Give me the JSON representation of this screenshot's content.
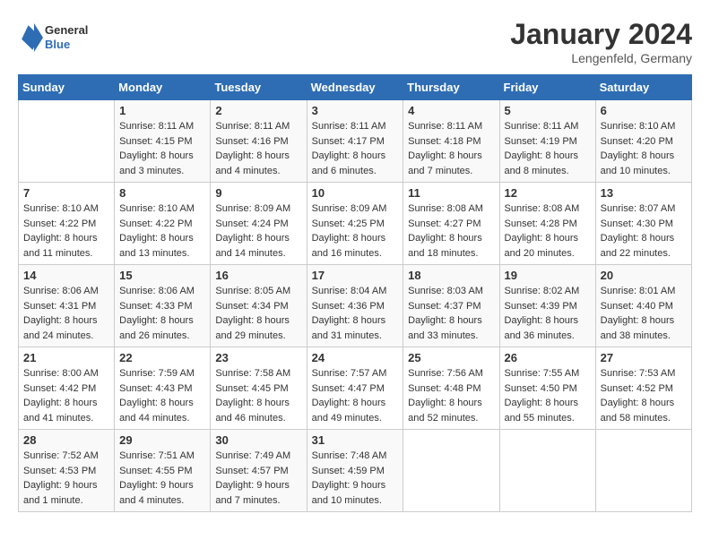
{
  "header": {
    "logo_general": "General",
    "logo_blue": "Blue",
    "title": "January 2024",
    "location": "Lengenfeld, Germany"
  },
  "days_of_week": [
    "Sunday",
    "Monday",
    "Tuesday",
    "Wednesday",
    "Thursday",
    "Friday",
    "Saturday"
  ],
  "weeks": [
    [
      {
        "day": "",
        "info": ""
      },
      {
        "day": "1",
        "info": "Sunrise: 8:11 AM\nSunset: 4:15 PM\nDaylight: 8 hours\nand 3 minutes."
      },
      {
        "day": "2",
        "info": "Sunrise: 8:11 AM\nSunset: 4:16 PM\nDaylight: 8 hours\nand 4 minutes."
      },
      {
        "day": "3",
        "info": "Sunrise: 8:11 AM\nSunset: 4:17 PM\nDaylight: 8 hours\nand 6 minutes."
      },
      {
        "day": "4",
        "info": "Sunrise: 8:11 AM\nSunset: 4:18 PM\nDaylight: 8 hours\nand 7 minutes."
      },
      {
        "day": "5",
        "info": "Sunrise: 8:11 AM\nSunset: 4:19 PM\nDaylight: 8 hours\nand 8 minutes."
      },
      {
        "day": "6",
        "info": "Sunrise: 8:10 AM\nSunset: 4:20 PM\nDaylight: 8 hours\nand 10 minutes."
      }
    ],
    [
      {
        "day": "7",
        "info": ""
      },
      {
        "day": "8",
        "info": "Sunrise: 8:10 AM\nSunset: 4:22 PM\nDaylight: 8 hours\nand 13 minutes."
      },
      {
        "day": "9",
        "info": "Sunrise: 8:09 AM\nSunset: 4:24 PM\nDaylight: 8 hours\nand 14 minutes."
      },
      {
        "day": "10",
        "info": "Sunrise: 8:09 AM\nSunset: 4:25 PM\nDaylight: 8 hours\nand 16 minutes."
      },
      {
        "day": "11",
        "info": "Sunrise: 8:08 AM\nSunset: 4:27 PM\nDaylight: 8 hours\nand 18 minutes."
      },
      {
        "day": "12",
        "info": "Sunrise: 8:08 AM\nSunset: 4:28 PM\nDaylight: 8 hours\nand 20 minutes."
      },
      {
        "day": "13",
        "info": "Sunrise: 8:07 AM\nSunset: 4:30 PM\nDaylight: 8 hours\nand 22 minutes."
      }
    ],
    [
      {
        "day": "14",
        "info": ""
      },
      {
        "day": "15",
        "info": "Sunrise: 8:06 AM\nSunset: 4:33 PM\nDaylight: 8 hours\nand 26 minutes."
      },
      {
        "day": "16",
        "info": "Sunrise: 8:05 AM\nSunset: 4:34 PM\nDaylight: 8 hours\nand 29 minutes."
      },
      {
        "day": "17",
        "info": "Sunrise: 8:04 AM\nSunset: 4:36 PM\nDaylight: 8 hours\nand 31 minutes."
      },
      {
        "day": "18",
        "info": "Sunrise: 8:03 AM\nSunset: 4:37 PM\nDaylight: 8 hours\nand 33 minutes."
      },
      {
        "day": "19",
        "info": "Sunrise: 8:02 AM\nSunset: 4:39 PM\nDaylight: 8 hours\nand 36 minutes."
      },
      {
        "day": "20",
        "info": "Sunrise: 8:01 AM\nSunset: 4:40 PM\nDaylight: 8 hours\nand 38 minutes."
      }
    ],
    [
      {
        "day": "21",
        "info": ""
      },
      {
        "day": "22",
        "info": "Sunrise: 7:59 AM\nSunset: 4:43 PM\nDaylight: 8 hours\nand 44 minutes."
      },
      {
        "day": "23",
        "info": "Sunrise: 7:58 AM\nSunset: 4:45 PM\nDaylight: 8 hours\nand 46 minutes."
      },
      {
        "day": "24",
        "info": "Sunrise: 7:57 AM\nSunset: 4:47 PM\nDaylight: 8 hours\nand 49 minutes."
      },
      {
        "day": "25",
        "info": "Sunrise: 7:56 AM\nSunset: 4:48 PM\nDaylight: 8 hours\nand 52 minutes."
      },
      {
        "day": "26",
        "info": "Sunrise: 7:55 AM\nSunset: 4:50 PM\nDaylight: 8 hours\nand 55 minutes."
      },
      {
        "day": "27",
        "info": "Sunrise: 7:53 AM\nSunset: 4:52 PM\nDaylight: 8 hours\nand 58 minutes."
      }
    ],
    [
      {
        "day": "28",
        "info": ""
      },
      {
        "day": "29",
        "info": "Sunrise: 7:51 AM\nSunset: 4:55 PM\nDaylight: 9 hours\nand 4 minutes."
      },
      {
        "day": "30",
        "info": "Sunrise: 7:49 AM\nSunset: 4:57 PM\nDaylight: 9 hours\nand 7 minutes."
      },
      {
        "day": "31",
        "info": "Sunrise: 7:48 AM\nSunset: 4:59 PM\nDaylight: 9 hours\nand 10 minutes."
      },
      {
        "day": "",
        "info": ""
      },
      {
        "day": "",
        "info": ""
      },
      {
        "day": "",
        "info": ""
      }
    ]
  ],
  "week_first_cells": {
    "7": "Sunrise: 8:10 AM\nSunset: 4:22 PM\nDaylight: 8 hours\nand 11 minutes.",
    "14": "Sunrise: 8:06 AM\nSunset: 4:31 PM\nDaylight: 8 hours\nand 24 minutes.",
    "21": "Sunrise: 8:00 AM\nSunset: 4:42 PM\nDaylight: 8 hours\nand 41 minutes.",
    "28": "Sunrise: 7:52 AM\nSunset: 4:53 PM\nDaylight: 9 hours\nand 1 minute."
  }
}
